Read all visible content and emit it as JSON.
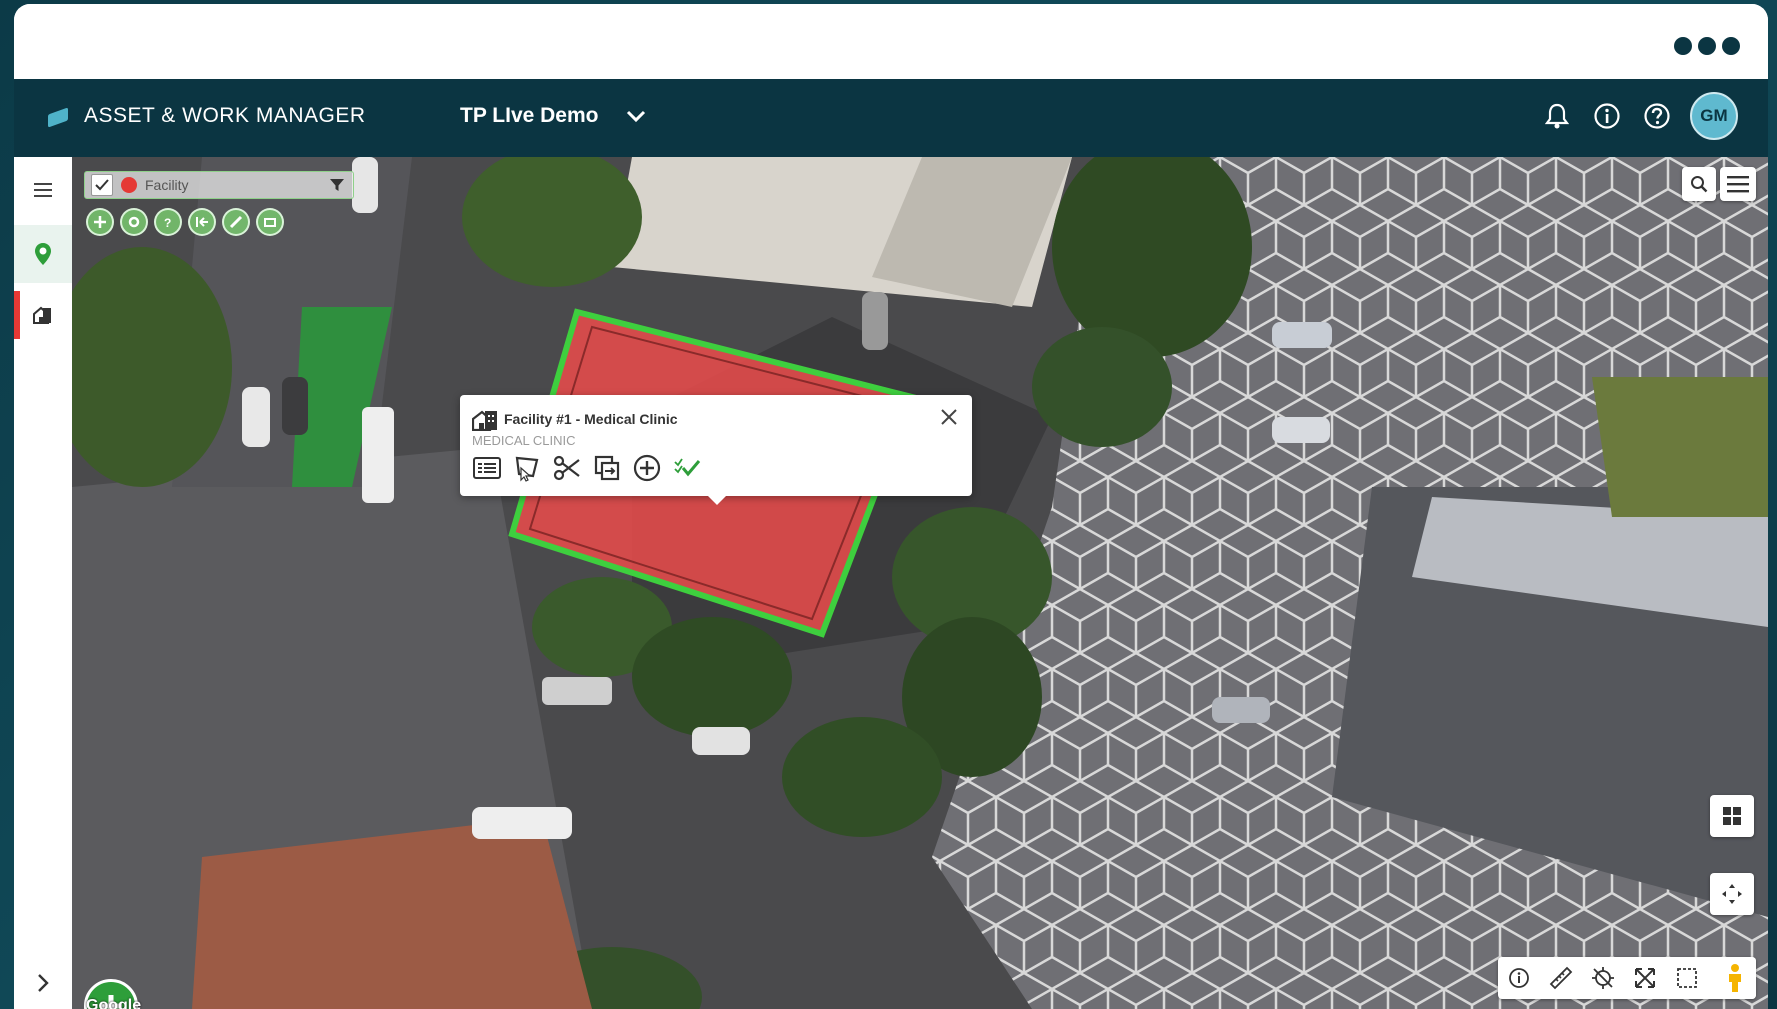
{
  "header": {
    "brand": "ASSET & WORK MANAGER",
    "project": "TP LIve Demo",
    "avatar_initials": "GM"
  },
  "layer_panel": {
    "layer_name": "Facility",
    "layer_checked": true,
    "layer_color": "#e53935"
  },
  "popup": {
    "title": "Facility #1 - Medical Clinic",
    "subtitle": "MEDICAL CLINIC"
  },
  "map": {
    "attribution": "Google"
  },
  "colors": {
    "topbar": "#0b3542",
    "accent": "#4fb3c9",
    "facility_fill": "#e64b4b",
    "facility_outline": "#3ecf3e",
    "fab": "#2e9e3a"
  },
  "icons": {
    "top": [
      "bell-icon",
      "info-icon",
      "help-icon"
    ],
    "sidebar": [
      "menu-icon",
      "map-pin-icon",
      "facility-icon",
      "chevron-right-icon"
    ],
    "popup_actions": [
      "details-icon",
      "edit-shape-icon",
      "scissors-icon",
      "copy-icon",
      "add-icon",
      "check-list-icon"
    ],
    "bottom_tools": [
      "info-icon",
      "ruler-icon",
      "locate-icon",
      "fullscreen-icon",
      "select-box-icon",
      "pegman-icon"
    ]
  }
}
